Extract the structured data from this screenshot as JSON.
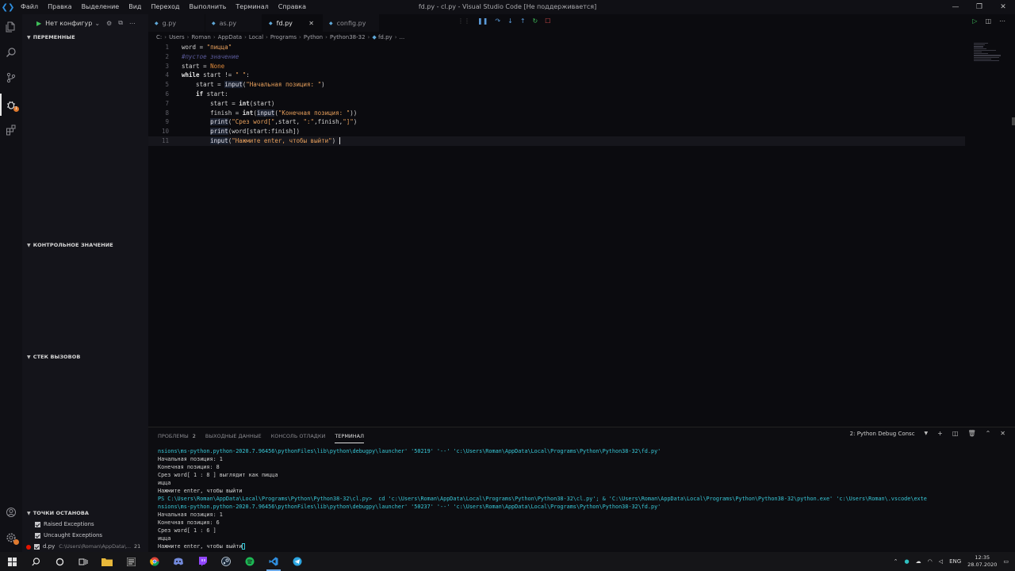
{
  "window": {
    "title": "fd.py - cl.py - Visual Studio Code [Не поддерживается]",
    "menu": [
      "Файл",
      "Правка",
      "Выделение",
      "Вид",
      "Переход",
      "Выполнить",
      "Терминал",
      "Справка"
    ],
    "controls": [
      "—",
      "❐",
      "✕"
    ]
  },
  "sidebar": {
    "config_label": "Нет конфигур",
    "sections": {
      "variables": "ПЕРЕМЕННЫЕ",
      "watch": "КОНТРОЛЬНОЕ ЗНАЧЕНИЕ",
      "callstack": "СТЕК ВЫЗОВОВ",
      "breakpoints": "ТОЧКИ ОСТАНОВА"
    },
    "breakpoints": {
      "raised": "Raised Exceptions",
      "uncaught": "Uncaught Exceptions",
      "file": "d.py",
      "file_path": "C:\\Users\\Roman\\AppData\\...",
      "file_line": "21"
    },
    "badge": "1"
  },
  "tabs": [
    {
      "label": "g.py"
    },
    {
      "label": "as.py"
    },
    {
      "label": "fd.py"
    },
    {
      "label": "config.py"
    }
  ],
  "breadcrumb": [
    "C:",
    "Users",
    "Roman",
    "AppData",
    "Local",
    "Programs",
    "Python",
    "Python38-32",
    "fd.py",
    "..."
  ],
  "code": {
    "line_numbers": [
      "1",
      "2",
      "3",
      "4",
      "5",
      "6",
      "7",
      "8",
      "9",
      "10",
      "11"
    ]
  },
  "panel": {
    "tabs": [
      "ПРОБЛЕМЫ",
      "ВЫХОДНЫЕ ДАННЫЕ",
      "КОНСОЛЬ ОТЛАДКИ",
      "ТЕРМИНАЛ"
    ],
    "problems_count": "2",
    "terminal_select": "2: Python Debug Consc",
    "terminal_lines": [
      "nsions\\ms-python.python-2020.7.96456\\pythonFiles\\lib\\python\\debugpy\\launcher' '50219' '--' 'c:\\Users\\Roman\\AppData\\Local\\Programs\\Python\\Python38-32\\fd.py'",
      "Начальная позиция: 1",
      "Конечная позиция: 8",
      "Срез word[ 1 : 8 ] выглядит как пицца",
      "ицца",
      "Нажмите enter, чтобы выйти",
      "PS C:\\Users\\Roman\\AppData\\Local\\Programs\\Python\\Python38-32\\cl.py>  cd 'c:\\Users\\Roman\\AppData\\Local\\Programs\\Python\\Python38-32\\cl.py'; & 'C:\\Users\\Roman\\AppData\\Local\\Programs\\Python\\Python38-32\\python.exe' 'c:\\Users\\Roman\\.vscode\\exte",
      "nsions\\ms-python.python-2020.7.96456\\pythonFiles\\lib\\python\\debugpy\\launcher' '50237' '--' 'c:\\Users\\Roman\\AppData\\Local\\Programs\\Python\\Python38-32\\fd.py'",
      "Начальная позиция: 1",
      "Конечная позиция: 6",
      "Срез word[ 1 : 6 ]",
      "ицца",
      "Нажмите enter, чтобы выйти"
    ]
  },
  "taskbar": {
    "lang": "ENG",
    "time": "12:35",
    "date": "28.07.2020"
  }
}
